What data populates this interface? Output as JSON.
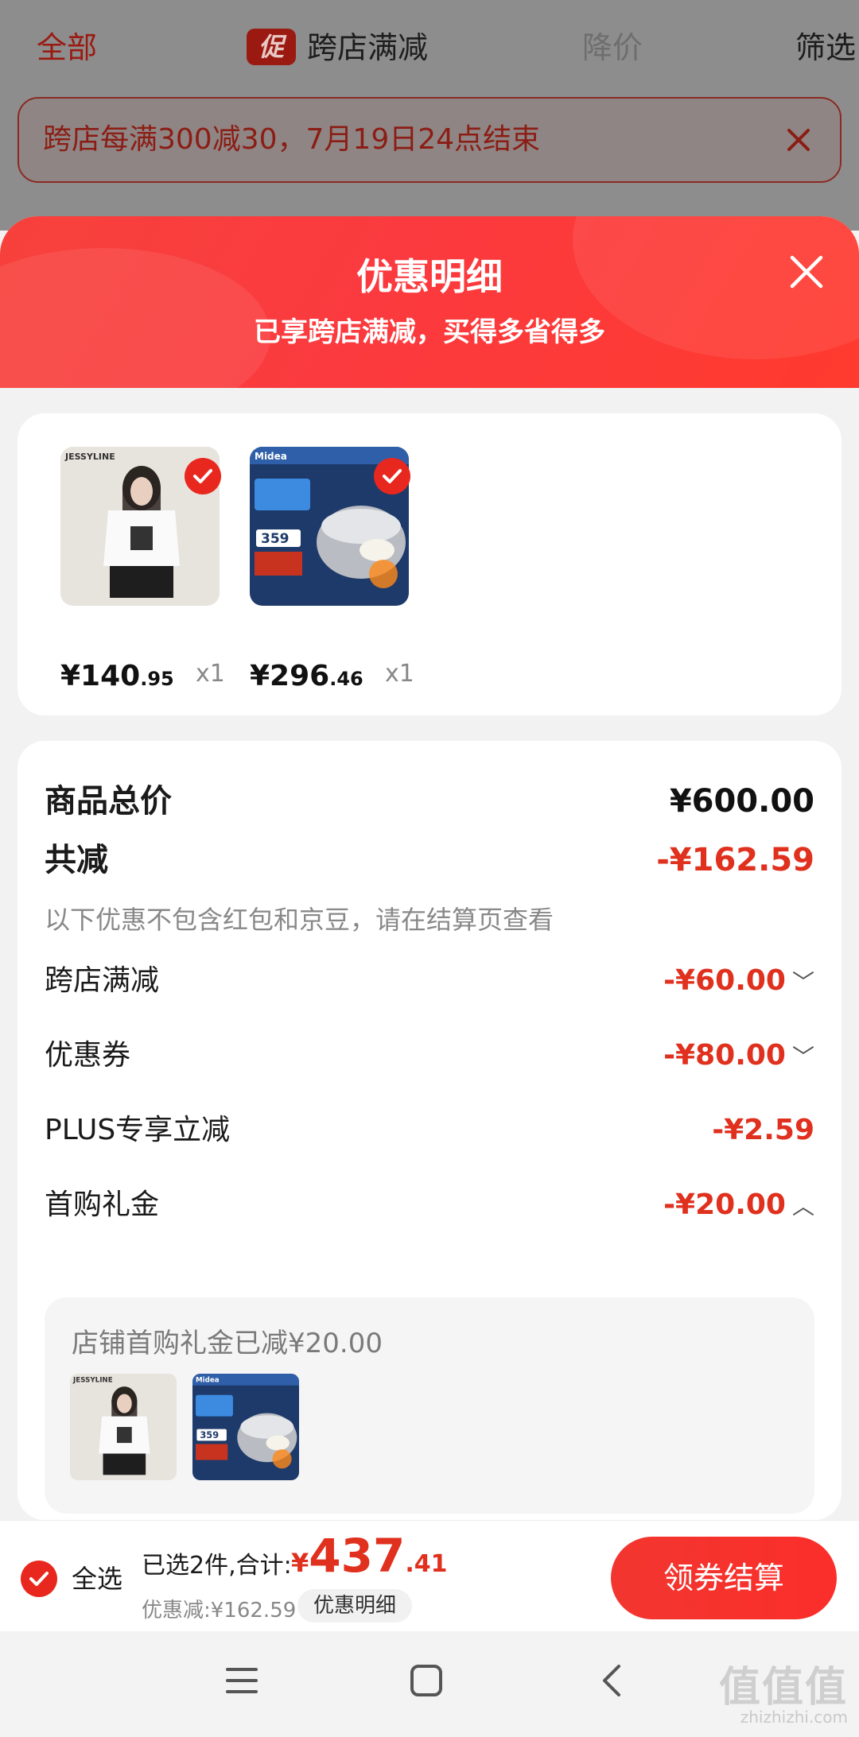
{
  "top_tabs": {
    "all": "全部",
    "promo_badge": "促",
    "cross_store": "跨店满减",
    "price_drop": "降价",
    "filter": "筛选"
  },
  "notice": {
    "text": "跨店每满300减30，7月19日24点结束"
  },
  "sheet": {
    "title": "优惠明细",
    "subtitle": "已享跨店满减，买得多省得多"
  },
  "products": [
    {
      "brand": "JESSYLINE",
      "price_int": "¥140",
      "price_dec": ".95",
      "qty": "x1"
    },
    {
      "brand": "Midea",
      "price_int": "¥296",
      "price_dec": ".46",
      "qty": "x1",
      "badge": "359"
    }
  ],
  "summary": {
    "total_label": "商品总价",
    "total_value": "¥600.00",
    "reduce_label": "共减",
    "reduce_value": "-¥162.59",
    "hint": "以下优惠不包含红包和京豆，请在结算页查看",
    "items": [
      {
        "label": "跨店满减",
        "value": "-¥60.00",
        "chevron": "﹀"
      },
      {
        "label": "优惠券",
        "value": "-¥80.00",
        "chevron": "﹀"
      },
      {
        "label": "PLUS专享立减",
        "value": "-¥2.59",
        "chevron": ""
      },
      {
        "label": "首购礼金",
        "value": "-¥20.00",
        "chevron": "︿"
      }
    ],
    "subbox_text": "店铺首购礼金已减¥20.00"
  },
  "bottom": {
    "select_all": "全选",
    "selected_label": "已选2件,合计:",
    "sum_currency": "¥",
    "sum_int": "437",
    "sum_dec": ".41",
    "discount_text": "优惠减:¥162.59",
    "detail_button": "优惠明细",
    "checkout_button": "领券结算"
  },
  "watermark": {
    "text": "值值值",
    "url": "zhizhizhi.com"
  },
  "colors": {
    "accent": "#e8281e",
    "price_red": "#e0301e"
  }
}
